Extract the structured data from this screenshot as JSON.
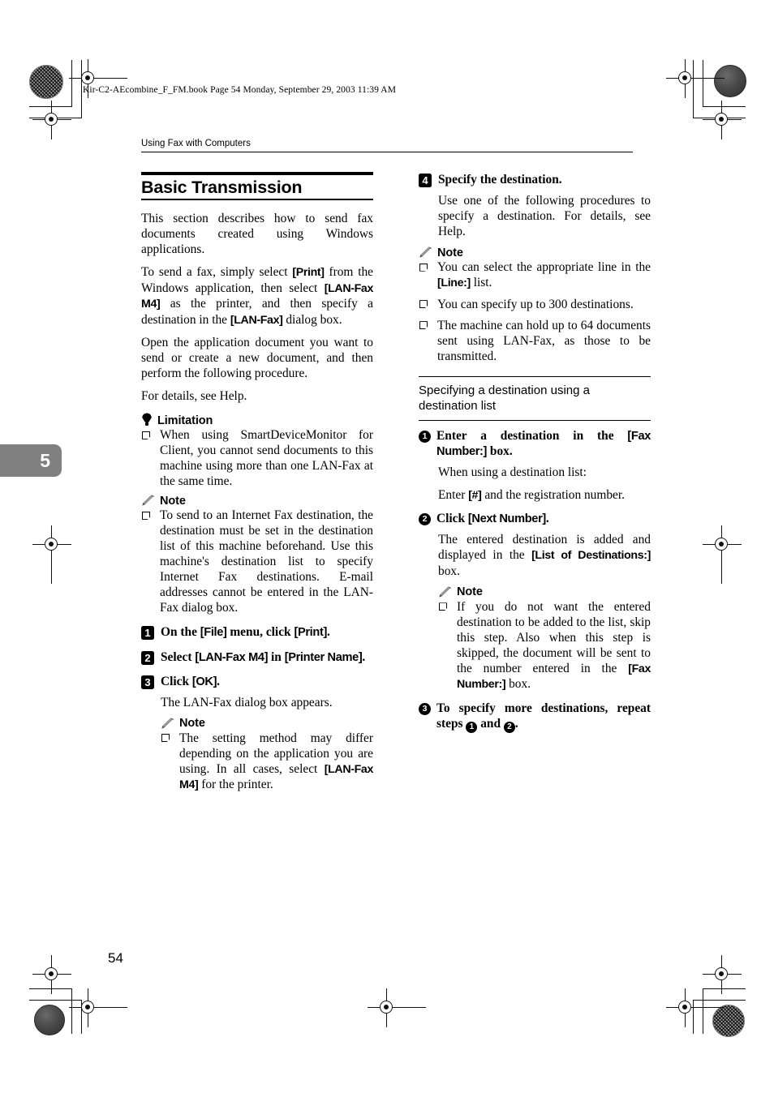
{
  "print_header": "Kir-C2-AEcombine_F_FM.book  Page 54  Monday, September 29, 2003  11:39 AM",
  "running_head": "Using Fax with Computers",
  "chapter_tab": "5",
  "page_number": "54",
  "section": {
    "title": "Basic Transmission",
    "intro_1": "This section describes how to send fax documents created using Windows applications.",
    "intro_2_a": "To send a fax, simply select ",
    "intro_2_print": "[Print]",
    "intro_2_b": " from the Windows application, then select ",
    "intro_2_lanfaxm4": "[LAN-Fax M4]",
    "intro_2_c": " as the printer, and then specify a destination in the ",
    "intro_2_lanfax": "[LAN-Fax]",
    "intro_2_d": " dialog box.",
    "intro_3": "Open the application document you want to send or create a new document, and then perform the following procedure.",
    "intro_4": "For details, see Help."
  },
  "limitation": {
    "label": "Limitation",
    "icon": "balloon-icon",
    "items": [
      "When using SmartDeviceMonitor for Client, you cannot send documents to this machine using more than one LAN-Fax at the same time."
    ]
  },
  "note_left_1": {
    "label": "Note",
    "icon": "pencil-icon",
    "items": [
      "To send to an Internet Fax destination, the destination must be set in the destination list of this machine beforehand. Use this machine's destination list to specify Internet Fax destinations. E-mail addresses cannot be entered in the LAN-Fax dialog box."
    ]
  },
  "steps_left": [
    {
      "num": "1",
      "head_a": "On the ",
      "head_ui1": "[File]",
      "head_b": " menu, click ",
      "head_ui2": "[Print]",
      "head_c": "."
    },
    {
      "num": "2",
      "head_a": "Select ",
      "head_ui1": "[LAN-Fax M4]",
      "head_b": " in ",
      "head_ui2": "[Printer Name]",
      "head_c": "."
    },
    {
      "num": "3",
      "head_a": "Click ",
      "head_ui1": "[OK]",
      "head_b": ".",
      "body": "The LAN-Fax dialog box appears."
    }
  ],
  "note_left_2": {
    "label": "Note",
    "icon": "pencil-icon",
    "item_a": "The setting method may differ depending on the application you are using. In all cases, select ",
    "item_ui": "[LAN-Fax M4]",
    "item_b": " for the printer."
  },
  "step_right_4": {
    "num": "4",
    "head": "Specify the destination.",
    "body": "Use one of the following procedures to specify a destination. For details, see Help."
  },
  "note_right_1": {
    "label": "Note",
    "icon": "pencil-icon",
    "item1_a": "You can select the appropriate line in the ",
    "item1_ui": "[Line:]",
    "item1_b": " list.",
    "item2": "You can specify up to 300 destinations.",
    "item3": "The machine can hold up to 64 documents sent using LAN-Fax, as those to be transmitted."
  },
  "subhead_right": "Specifying a destination using a destination list",
  "substeps_right": [
    {
      "num": "1",
      "head_a": "Enter a destination in the ",
      "head_ui": "[Fax Number:]",
      "head_b": " box.",
      "body_1": "When using a destination list:",
      "body_2_a": "Enter ",
      "body_2_ui": "[#]",
      "body_2_b": " and the registration number."
    },
    {
      "num": "2",
      "head_a": "Click ",
      "head_ui": "[Next Number]",
      "head_b": ".",
      "body_a": "The entered destination is added and displayed in the ",
      "body_ui": "[List of Destinations:]",
      "body_b": " box."
    }
  ],
  "note_right_2": {
    "label": "Note",
    "icon": "pencil-icon",
    "item_a": "If you do not want the entered destination to be added to the list, skip this step. Also when this step is skipped, the document will be sent to the number entered in the ",
    "item_ui": "[Fax Number:]",
    "item_b": " box."
  },
  "substep_right_3": {
    "num": "3",
    "head_a": "To specify more destinations, repeat steps ",
    "ref_1": "1",
    "head_b": " and ",
    "ref_2": "2",
    "head_c": "."
  }
}
